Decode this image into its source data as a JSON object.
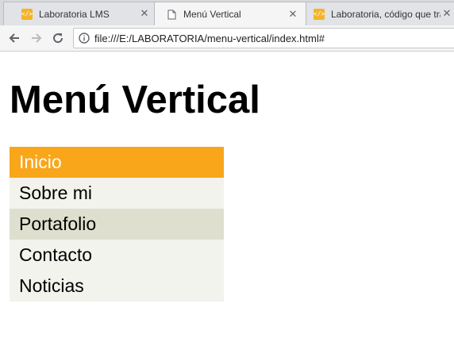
{
  "browser": {
    "tabs": [
      {
        "title": "Laboratoria LMS",
        "favicon": "laboratoria-icon",
        "active": false
      },
      {
        "title": "Menú Vertical",
        "favicon": "page-icon",
        "active": true
      },
      {
        "title": "Laboratoria, código que transforma",
        "favicon": "laboratoria-icon",
        "active": false
      }
    ],
    "address": {
      "url": "file:///E:/LABORATORIA/menu-vertical/index.html#"
    }
  },
  "page": {
    "heading": "Menú Vertical",
    "menu": [
      {
        "label": "Inicio",
        "state": "active"
      },
      {
        "label": "Sobre mi",
        "state": "normal"
      },
      {
        "label": "Portafolio",
        "state": "hover"
      },
      {
        "label": "Contacto",
        "state": "normal"
      },
      {
        "label": "Noticias",
        "state": "normal"
      }
    ]
  },
  "colors": {
    "menu_active": "#f9a61a",
    "menu_hover": "#dfdfcf",
    "menu_normal": "#f2f3ec",
    "favicon_laboratoria": "#f5b325"
  }
}
